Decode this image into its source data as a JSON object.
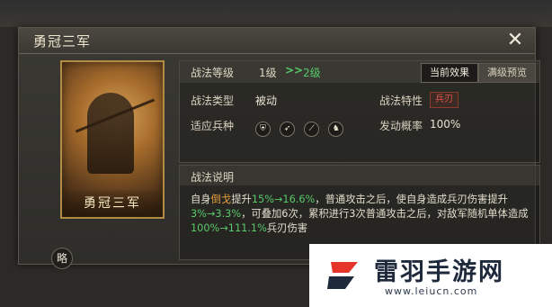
{
  "dialog": {
    "title": "勇冠三军"
  },
  "portrait": {
    "name": "勇冠三军",
    "abbrev_badge": "略"
  },
  "tabs": {
    "current_effect": "当前效果",
    "max_preview": "满级预览"
  },
  "level": {
    "label": "战法等级",
    "current": "1级",
    "arrow": ">>",
    "next": "2级"
  },
  "fields": {
    "type_label": "战法类型",
    "type_value": "被动",
    "trait_label": "战法特性",
    "trait_value": "兵刃",
    "troop_label": "适应兵种",
    "troop_icons": [
      "shield-icon",
      "bow-icon",
      "spear-icon",
      "horse-icon"
    ],
    "rate_label": "发动概率",
    "rate_value": "100%"
  },
  "description": {
    "title": "战法说明",
    "p1": "自身",
    "term": "倒戈",
    "p2": "提升",
    "v1": "15%→16.6%",
    "p3": "，普通攻击之后，使自身造成兵刃伤害提升",
    "v2": "3%→3.3%",
    "p4": "，可叠加6次，累积进行3次普通攻击之后，对敌军随机单体造成",
    "v3": "100%→111.1%",
    "p5": "兵刃伤害"
  },
  "watermark": {
    "name": "雷羽手游网",
    "url": "www.leiucn.com"
  },
  "colors": {
    "highlight_green": "#59c96a",
    "term_orange": "#e39b3a",
    "trait_red": "#e0574a"
  }
}
